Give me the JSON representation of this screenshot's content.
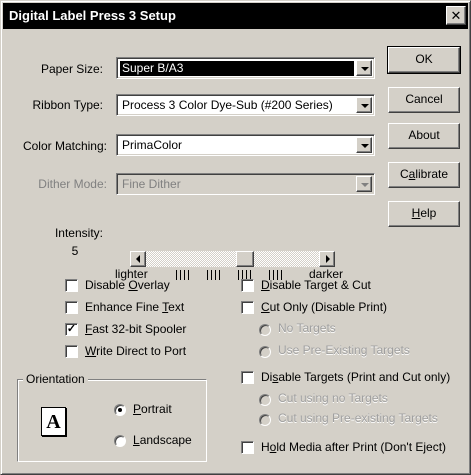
{
  "window": {
    "title": "Digital Label Press 3 Setup",
    "close_glyph": "✕"
  },
  "fields": {
    "paper_size": {
      "label": "Paper Size:",
      "value": "Super B/A3"
    },
    "ribbon_type": {
      "label": "Ribbon Type:",
      "value": "Process 3 Color Dye-Sub (#200 Series)"
    },
    "color_matching": {
      "label": "Color Matching:",
      "value": "PrimaColor"
    },
    "dither_mode": {
      "label": "Dither Mode:",
      "value": "Fine Dither",
      "disabled": true
    }
  },
  "buttons": {
    "ok": "OK",
    "cancel": "Cancel",
    "about": "About",
    "calibrate_prefix": "C",
    "calibrate_ul": "a",
    "calibrate_rest": "librate",
    "help_ul": "H",
    "help_rest": "elp"
  },
  "intensity": {
    "label": "Intensity:",
    "value": "5",
    "lighter": "lighter",
    "darker": "darker",
    "level_fraction": 0.58
  },
  "left_options": [
    {
      "pre": "Disable ",
      "ul": "O",
      "post": "verlay",
      "checked": false
    },
    {
      "pre": "Enhance Fine ",
      "ul": "T",
      "post": "ext",
      "checked": false
    },
    {
      "pre": "",
      "ul": "F",
      "post": "ast 32-bit Spooler",
      "checked": true
    },
    {
      "pre": "",
      "ul": "W",
      "post": "rite Direct to Port",
      "checked": false
    }
  ],
  "right_options": {
    "disable_target_cut": {
      "pre": "",
      "ul": "D",
      "post": "isable Target & Cut",
      "checked": false
    },
    "cut_only": {
      "pre": "",
      "ul": "C",
      "post": "ut Only (Disable Print)",
      "checked": false
    },
    "no_targets": "No Targets",
    "use_existing": "Use Pre-Existing Targets",
    "disable_targets": {
      "pre": "Di",
      "ul": "s",
      "post": "able Targets (Print and Cut only)",
      "checked": false
    },
    "cut_no_targets": "Cut using no Targets",
    "cut_existing": "Cut using Pre-existing Targets",
    "hold_media": {
      "pre": "H",
      "ul": "o",
      "post": "ld Media after Print (Don't Eject)",
      "checked": false
    }
  },
  "orientation": {
    "label": "Orientation",
    "icon_letter": "A",
    "portrait_ul": "P",
    "portrait_rest": "ortrait",
    "landscape_ul": "L",
    "landscape_rest": "andscape",
    "selected": "portrait"
  },
  "check_glyph": "✓"
}
